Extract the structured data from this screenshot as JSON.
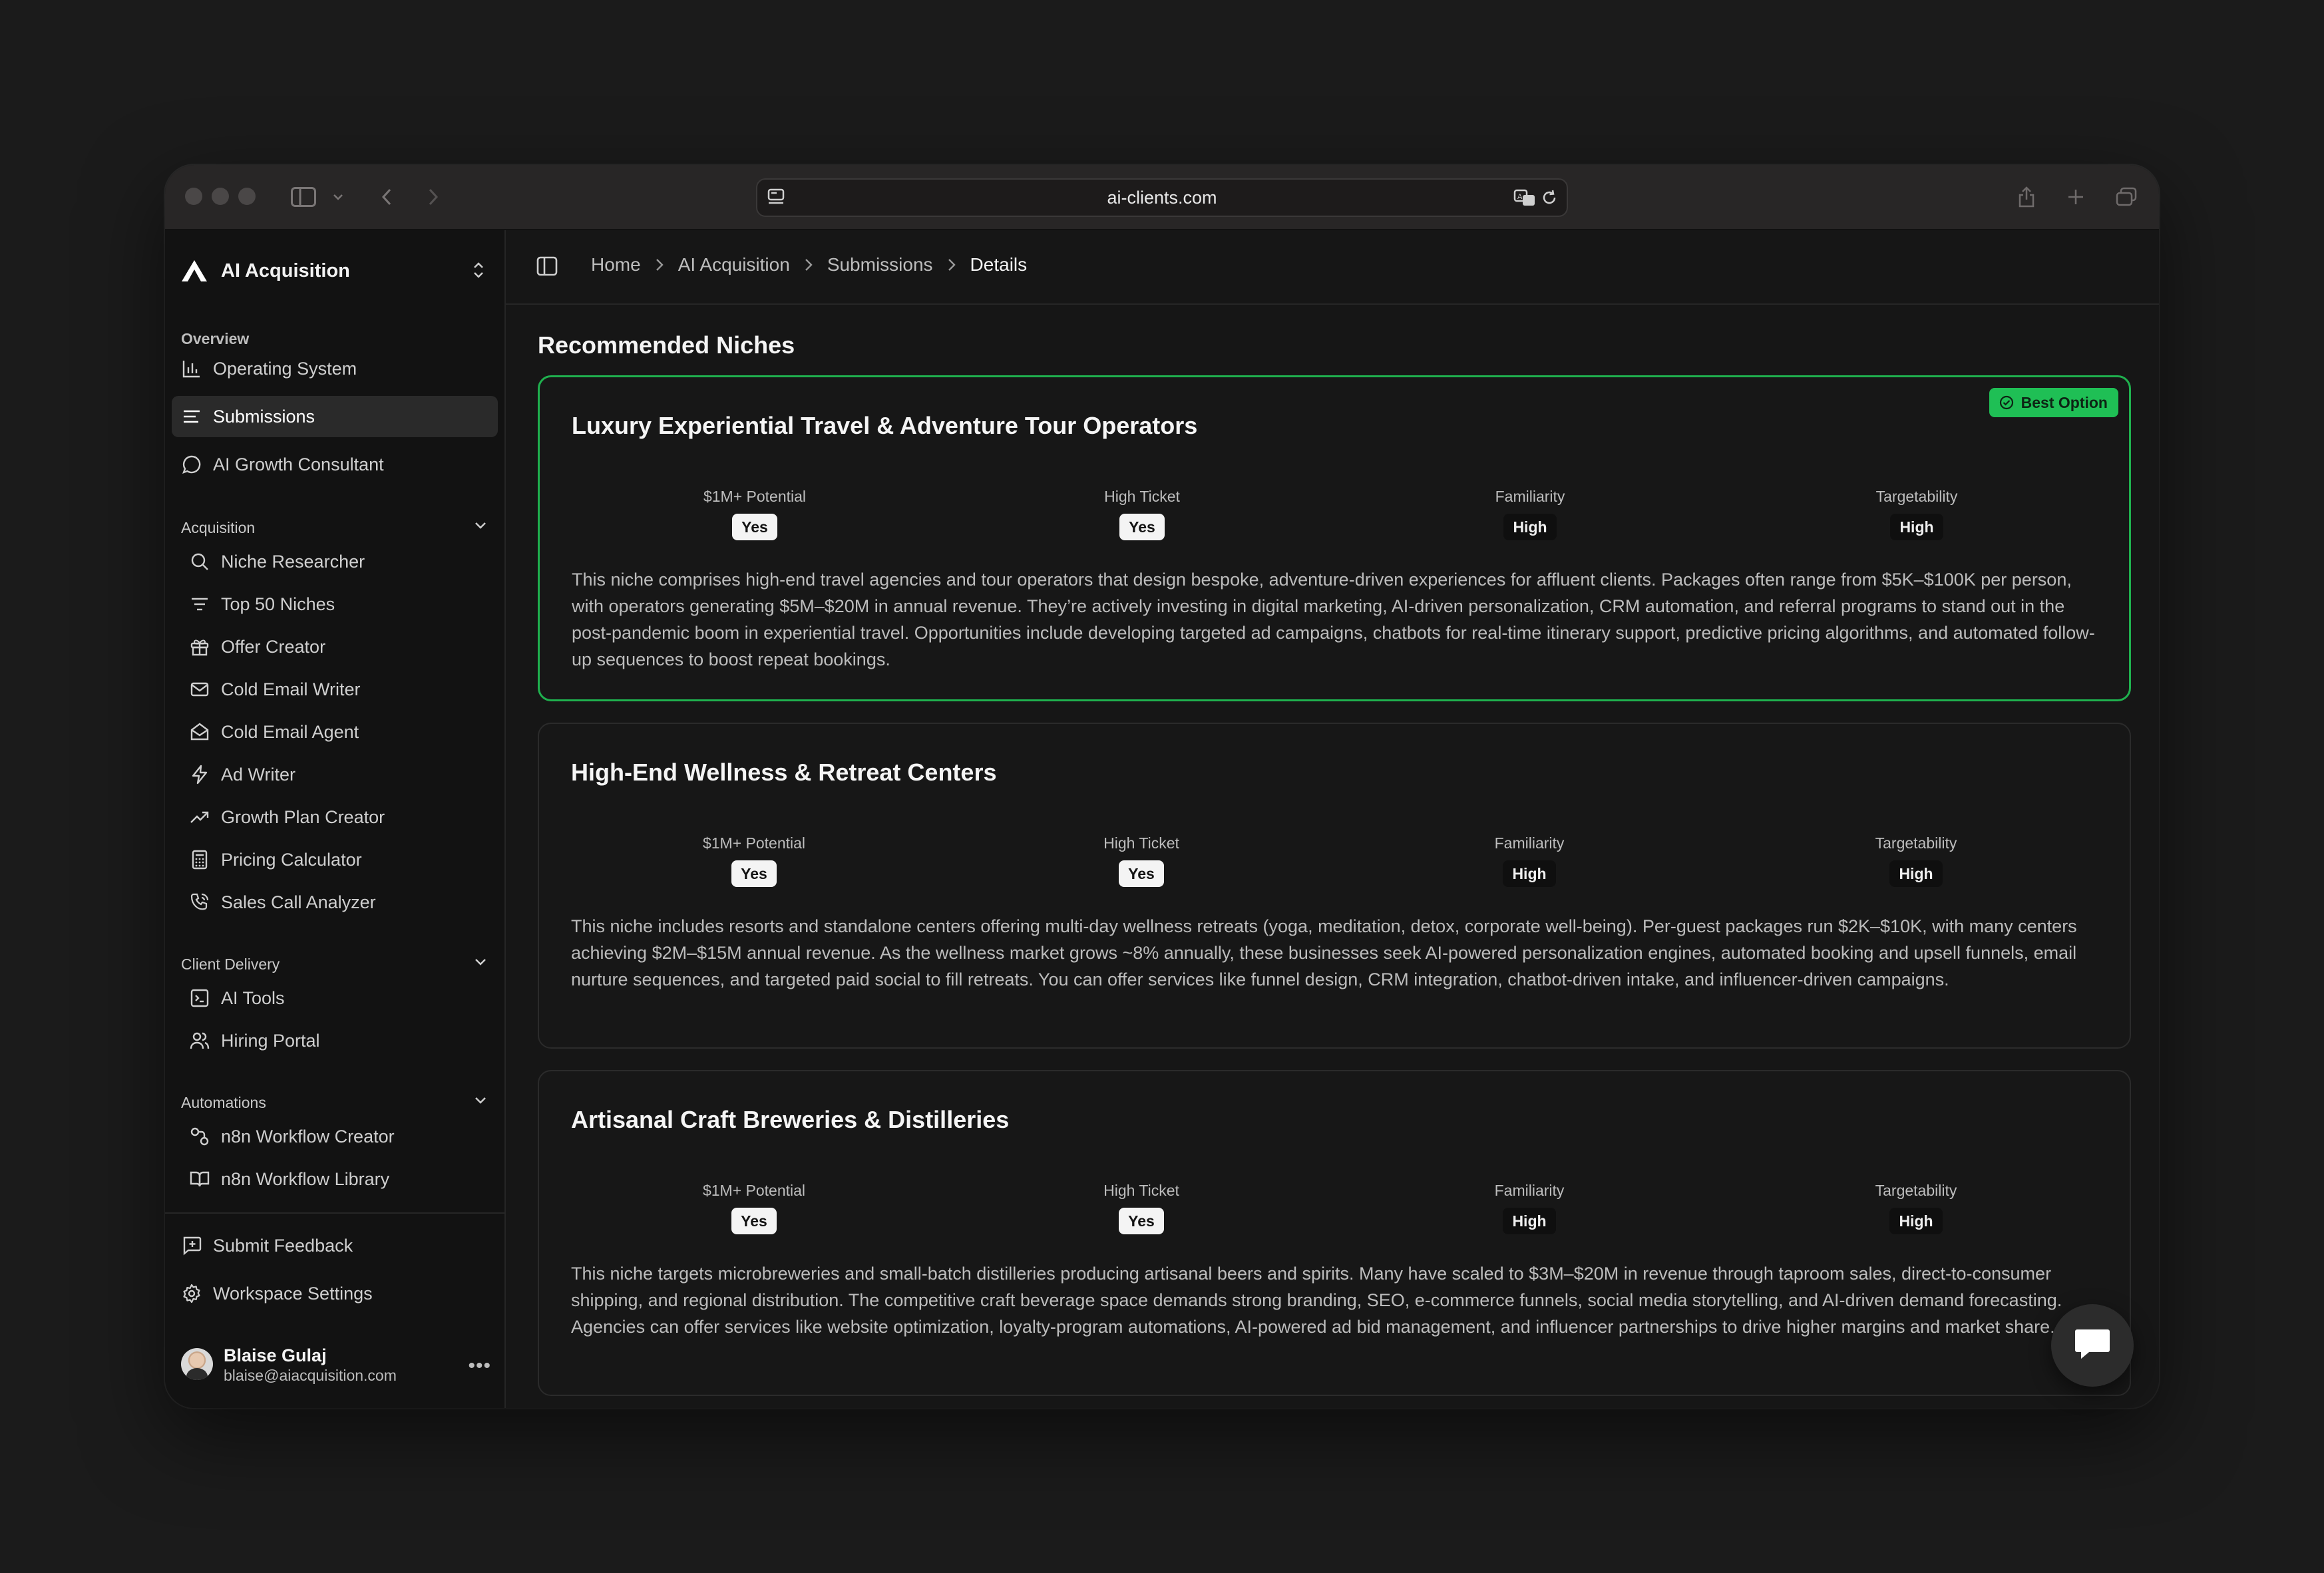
{
  "browser": {
    "url": "ai-clients.com"
  },
  "workspace": {
    "name": "AI Acquisition"
  },
  "sidebar": {
    "overview_label": "Overview",
    "overview_items": [
      {
        "label": "Operating System",
        "icon": "bar-chart-icon"
      },
      {
        "label": "Submissions",
        "icon": "list-icon",
        "active": true
      },
      {
        "label": "AI Growth Consultant",
        "icon": "message-circle-icon"
      }
    ],
    "acquisition_label": "Acquisition",
    "acquisition_items": [
      {
        "label": "Niche Researcher",
        "icon": "search-icon"
      },
      {
        "label": "Top 50 Niches",
        "icon": "filter-icon"
      },
      {
        "label": "Offer Creator",
        "icon": "gift-icon"
      },
      {
        "label": "Cold Email Writer",
        "icon": "mail-icon"
      },
      {
        "label": "Cold Email Agent",
        "icon": "mail-open-icon"
      },
      {
        "label": "Ad Writer",
        "icon": "zap-icon"
      },
      {
        "label": "Growth Plan Creator",
        "icon": "trending-up-icon"
      },
      {
        "label": "Pricing Calculator",
        "icon": "calculator-icon"
      },
      {
        "label": "Sales Call Analyzer",
        "icon": "phone-call-icon"
      }
    ],
    "client_delivery_label": "Client Delivery",
    "client_delivery_items": [
      {
        "label": "AI Tools",
        "icon": "terminal-icon"
      },
      {
        "label": "Hiring Portal",
        "icon": "users-icon"
      }
    ],
    "automations_label": "Automations",
    "automations_items": [
      {
        "label": "n8n Workflow Creator",
        "icon": "workflow-icon"
      },
      {
        "label": "n8n Workflow Library",
        "icon": "book-open-icon"
      }
    ],
    "footer_items": [
      {
        "label": "Submit Feedback",
        "icon": "message-square-plus-icon"
      },
      {
        "label": "Workspace Settings",
        "icon": "settings-icon"
      }
    ],
    "user": {
      "name": "Blaise Gulaj",
      "email": "blaise@aiacquisition.com"
    }
  },
  "breadcrumb": [
    "Home",
    "AI Acquisition",
    "Submissions",
    "Details"
  ],
  "main": {
    "section_title": "Recommended Niches",
    "best_option_label": "Best Option",
    "niches": [
      {
        "title": "Luxury Experiential Travel & Adventure Tour Operators",
        "best": true,
        "metrics": [
          {
            "label": "$1M+ Potential",
            "value": "Yes"
          },
          {
            "label": "High Ticket",
            "value": "Yes"
          },
          {
            "label": "Familiarity",
            "value": "High"
          },
          {
            "label": "Targetability",
            "value": "High"
          }
        ],
        "description": "This niche comprises high-end travel agencies and tour operators that design bespoke, adventure-driven experiences for affluent clients. Packages often range from $5K–$100K per person, with operators generating $5M–$20M in annual revenue. They’re actively investing in digital marketing, AI-driven personalization, CRM automation, and referral programs to stand out in the post-pandemic boom in experiential travel. Opportunities include developing targeted ad campaigns, chatbots for real-time itinerary support, predictive pricing algorithms, and automated follow-up sequences to boost repeat bookings."
      },
      {
        "title": "High-End Wellness & Retreat Centers",
        "best": false,
        "metrics": [
          {
            "label": "$1M+ Potential",
            "value": "Yes"
          },
          {
            "label": "High Ticket",
            "value": "Yes"
          },
          {
            "label": "Familiarity",
            "value": "High"
          },
          {
            "label": "Targetability",
            "value": "High"
          }
        ],
        "description": "This niche includes resorts and standalone centers offering multi-day wellness retreats (yoga, meditation, detox, corporate well-being). Per-guest packages run $2K–$10K, with many centers achieving $2M–$15M annual revenue. As the wellness market grows ~8% annually, these businesses seek AI-powered personalization engines, automated booking and upsell funnels, email nurture sequences, and targeted paid social to fill retreats. You can offer services like funnel design, CRM integration, chatbot-driven intake, and influencer-driven campaigns."
      },
      {
        "title": "Artisanal Craft Breweries & Distilleries",
        "best": false,
        "metrics": [
          {
            "label": "$1M+ Potential",
            "value": "Yes"
          },
          {
            "label": "High Ticket",
            "value": "Yes"
          },
          {
            "label": "Familiarity",
            "value": "High"
          },
          {
            "label": "Targetability",
            "value": "High"
          }
        ],
        "description": "This niche targets microbreweries and small-batch distilleries producing artisanal beers and spirits. Many have scaled to $3M–$20M in revenue through taproom sales, direct-to-consumer shipping, and regional distribution. The competitive craft beverage space demands strong branding, SEO, e-commerce funnels, social media storytelling, and AI-driven demand forecasting. Agencies can offer services like website optimization, loyalty-program automations, AI-powered ad bid management, and influencer partnerships to drive higher margins and market share."
      }
    ]
  },
  "colors": {
    "accent_green": "#1fbf55",
    "background": "#161616",
    "sidebar": "#121212"
  }
}
